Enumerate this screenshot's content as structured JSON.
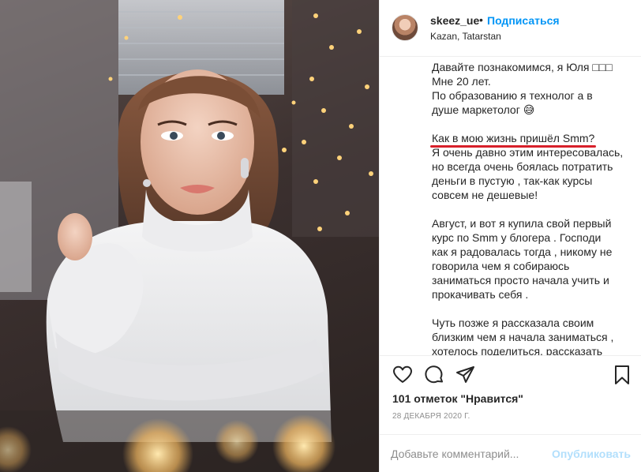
{
  "post": {
    "photo_icon": "portrait-photo",
    "header": {
      "username": "skeez_ue",
      "separator": "•",
      "follow_label": "Подписаться",
      "location": "Kazan, Tatarstan"
    },
    "caption": {
      "lines_intro": [
        "Давайте познакомимся, я Юля □□□",
        "Мне 20 лет.",
        "По образованию я технолог а в",
        "душе маркетолог 😅"
      ],
      "highlight": "Как в мою жизнь пришёл Smm?",
      "lines_story": [
        "Я очень давно этим интересовалась,",
        "но всегда очень боялась потратить",
        "деньги в пустую , так-как курсы",
        "совсем не дешевые!"
      ],
      "lines_august": [
        "Август, и вот я купила свой первый",
        "курс по Smm у блогера . Господи",
        "как я радовалась тогда , никому не",
        "говорила чем я собираюсь",
        "заниматься просто начала учить и",
        "прокачивать себя ."
      ],
      "lines_later": [
        "Чуть позже я рассказала своим",
        "близким чем я начала заниматься ,",
        "хотелось поделиться, рассказать"
      ]
    },
    "actions": {
      "icons": [
        "heart-icon",
        "comment-icon",
        "share-icon",
        "bookmark-icon"
      ],
      "likes_text": "101 отметок \"Нравится\"",
      "date": "28 ДЕКАБРЯ 2020 Г."
    },
    "comment": {
      "placeholder": "Добавьте комментарий...",
      "publish_label": "Опубликовать"
    },
    "colors": {
      "accent": "#0095f6",
      "publish_disabled": "#b2dffc",
      "highlight_line": "#d7202a",
      "muted": "#8e8e8e"
    }
  }
}
